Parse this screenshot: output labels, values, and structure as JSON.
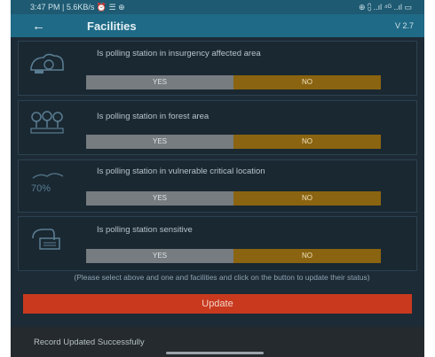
{
  "status_bar": {
    "left": "3:47 PM | 5.6KB/s ⏰ ☰ ⊕",
    "right": "⊕ ⩉ ..ıl ⁴ᴳ ..ıl ▭"
  },
  "app_bar": {
    "back_icon": "back-arrow-icon",
    "title": "Facilities",
    "version": "V 2.7"
  },
  "facilities": [
    {
      "icon": "insurgency-icon",
      "question": "Is polling station in insurgency affected area",
      "yes_label": "YES",
      "no_label": "NO",
      "selected": "no"
    },
    {
      "icon": "forest-icon",
      "question": "Is polling station in forest area",
      "yes_label": "YES",
      "no_label": "NO",
      "selected": "no"
    },
    {
      "icon": "vulnerable-icon",
      "icon_text": "70%",
      "question": "Is polling station in vulnerable critical location",
      "yes_label": "YES",
      "no_label": "NO",
      "selected": "no"
    },
    {
      "icon": "sensitive-icon",
      "question": "Is polling station sensitive",
      "yes_label": "YES",
      "no_label": "NO",
      "selected": "no"
    }
  ],
  "note": "(Please select above and one and facilities and click on the button to update their status)",
  "update_button": "Update",
  "toast": "Record Updated Successfully",
  "colors": {
    "app_bar": "#1f6a86",
    "status_bar": "#1e5a72",
    "background": "#1d2b36",
    "yes_button": "#767c80",
    "no_button": "#8a6410",
    "update_button": "#c8391e"
  }
}
